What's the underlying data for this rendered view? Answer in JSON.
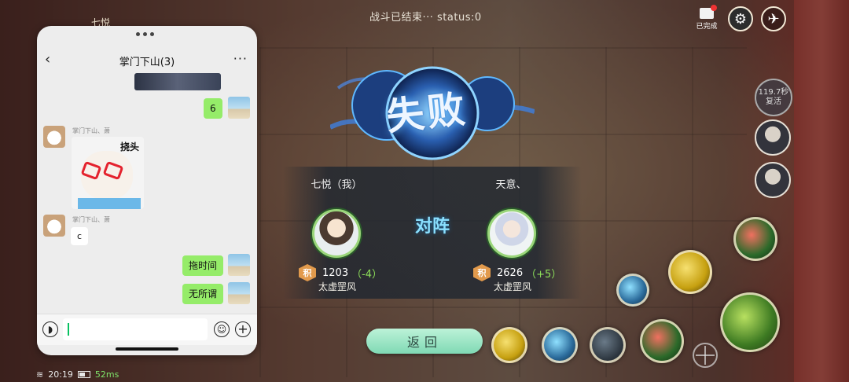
{
  "hud": {
    "status_text": "战斗已结束··· status:0",
    "player_top_name": "七悦",
    "completed_label": "已完成",
    "timer_text": "119.7秒",
    "timer_sub": "复活"
  },
  "result": {
    "title": "失败",
    "vs_label": "对阵",
    "left_player": {
      "name": "七悦（我）",
      "score": "1203",
      "delta": "（-4）",
      "rank": "太虚罡风",
      "badge": "积"
    },
    "right_player": {
      "name": "天意、",
      "score": "2626",
      "delta": "（+5）",
      "rank": "太虚罡风",
      "badge": "积"
    },
    "back_button": "返回"
  },
  "system": {
    "time": "20:19",
    "ping": "52ms"
  },
  "chat": {
    "title": "掌门下山(3)",
    "back_icon": "‹",
    "more_icon": "···",
    "messages": [
      {
        "from": "me",
        "text": "6"
      },
      {
        "from": "other",
        "sender": "掌门下山、萧",
        "sticker_caption": "挠头"
      },
      {
        "from": "other",
        "sender": "掌门下山、萧",
        "text": "c"
      },
      {
        "from": "me",
        "text": "拖时间"
      },
      {
        "from": "me",
        "text": "无所谓"
      }
    ],
    "input_placeholder": ""
  },
  "colors": {
    "accent_green": "#95ec69",
    "back_button": "#7fd9b4",
    "title_glow": "#5fb8ff"
  }
}
